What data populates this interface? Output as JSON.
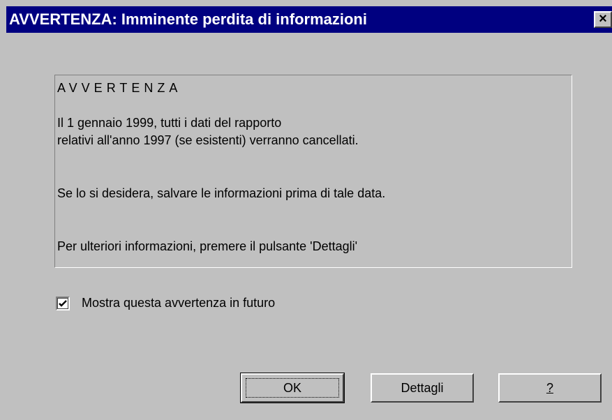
{
  "window": {
    "title": "AVVERTENZA: Imminente perdita di informazioni",
    "close_label": "×"
  },
  "message": {
    "heading": "AVVERTENZA",
    "line1": "Il 1 gennaio 1999, tutti i dati del rapporto",
    "line2": "relativi all'anno 1997 (se esistenti) verranno cancellati.",
    "line3": "Se lo si desidera, salvare le informazioni prima di tale data.",
    "line4": "Per ulteriori informazioni, premere il pulsante 'Dettagli'"
  },
  "checkbox": {
    "label": "Mostra questa avvertenza in futuro",
    "checked": true
  },
  "buttons": {
    "ok": "OK",
    "details": "Dettagli",
    "help": "?"
  },
  "colors": {
    "titlebar": "#000080",
    "face": "#c0c0c0"
  }
}
